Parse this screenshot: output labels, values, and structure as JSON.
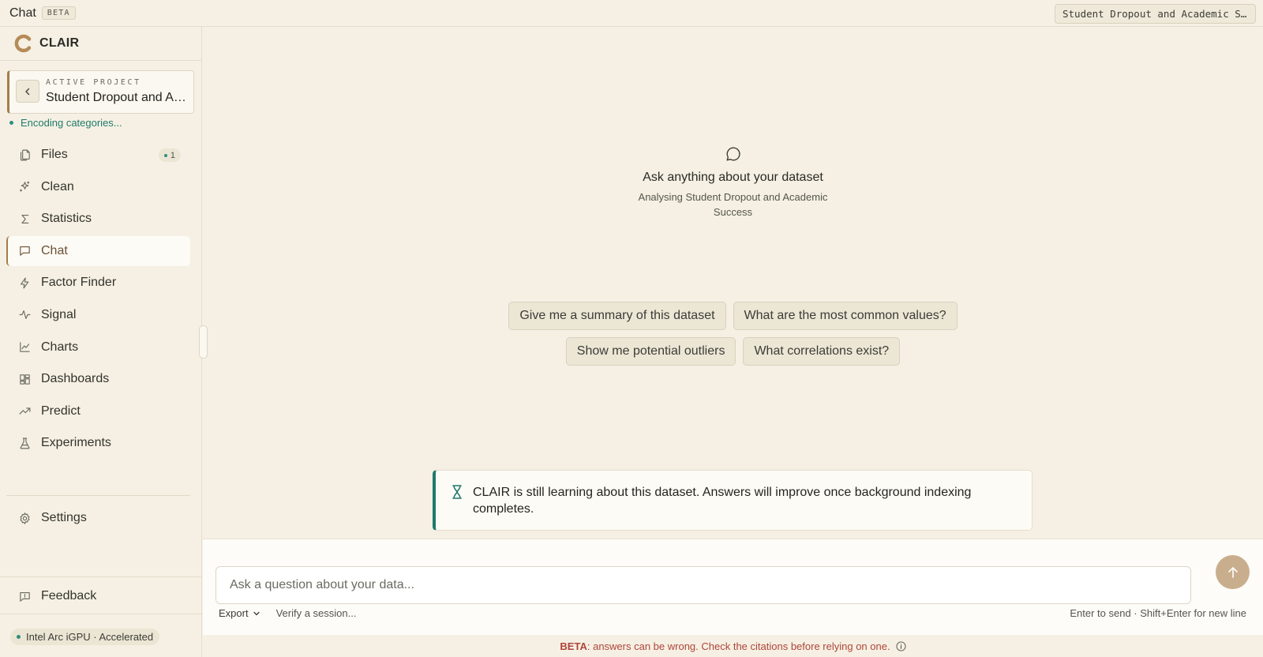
{
  "topbar": {
    "title": "Chat",
    "badge": "BETA",
    "project_chip": "Student Dropout and Academic Success"
  },
  "brand": {
    "name": "CLAIR"
  },
  "active_project": {
    "label": "ACTIVE PROJECT",
    "name": "Student Dropout and Academic Success"
  },
  "status": {
    "encoding": "Encoding categories..."
  },
  "nav": {
    "items": [
      {
        "label": "Files",
        "icon": "files-icon",
        "badge": "1"
      },
      {
        "label": "Clean",
        "icon": "sparkle-icon"
      },
      {
        "label": "Statistics",
        "icon": "sigma-icon"
      },
      {
        "label": "Chat",
        "icon": "chat-icon",
        "active": true
      },
      {
        "label": "Factor Finder",
        "icon": "bolt-icon"
      },
      {
        "label": "Signal",
        "icon": "pulse-icon"
      },
      {
        "label": "Charts",
        "icon": "line-chart-icon"
      },
      {
        "label": "Dashboards",
        "icon": "dashboard-icon"
      },
      {
        "label": "Predict",
        "icon": "trending-up-icon"
      },
      {
        "label": "Experiments",
        "icon": "flask-icon"
      }
    ],
    "settings": "Settings",
    "feedback": "Feedback"
  },
  "gpu": {
    "label": "Intel Arc iGPU · Accelerated"
  },
  "empty_state": {
    "title": "Ask anything about your dataset",
    "subtitle": "Analysing Student Dropout and Academic Success"
  },
  "suggestions": [
    "Give me a summary of this dataset",
    "What are the most common values?",
    "Show me potential outliers",
    "What correlations exist?"
  ],
  "notice": {
    "text": "CLAIR is still learning about this dataset. Answers will improve once background indexing completes."
  },
  "composer": {
    "placeholder": "Ask a question about your data...",
    "export": "Export",
    "verify": "Verify a session...",
    "hint": "Enter to send · Shift+Enter for new line"
  },
  "footer": {
    "beta_strong": "BETA",
    "beta_text": ": answers can be wrong. Check the citations before relying on one."
  },
  "colors": {
    "background": "#f5f0e3",
    "accent_teal": "#1f7a6c",
    "accent_brown": "#a47c4c",
    "warning_red": "#b0453a",
    "send_button": "#c9ae8e"
  }
}
